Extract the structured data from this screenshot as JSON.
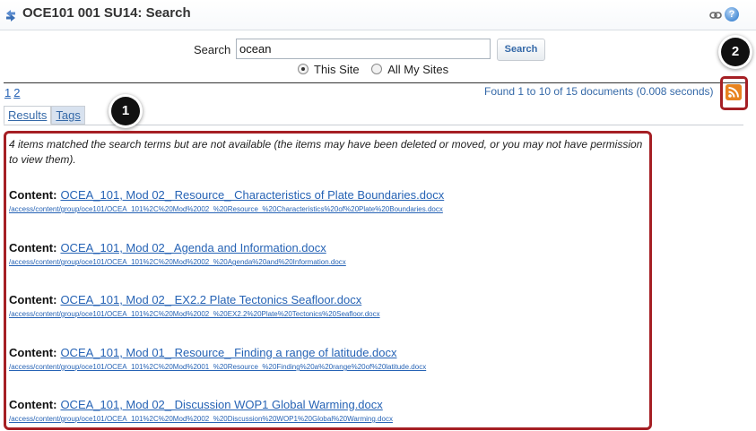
{
  "header": {
    "title": "OCE101 001 SU14: Search",
    "title_icon": "reset-arrows-icon",
    "link_icon": "link-icon",
    "help_icon": "help-icon",
    "help_glyph": "?"
  },
  "search": {
    "label": "Search",
    "value": "ocean",
    "button_label": "Search",
    "scope_options": [
      {
        "label": "This Site",
        "selected": true
      },
      {
        "label": "All My Sites",
        "selected": false
      }
    ]
  },
  "pagination": {
    "pages": [
      "1",
      "2"
    ]
  },
  "results_summary": "Found 1 to 10 of 15 documents (0.008 seconds)",
  "tabs": [
    {
      "label": "Results",
      "active": true
    },
    {
      "label": "Tags",
      "active": false
    }
  ],
  "notice": "4 items matched the search terms but are not available (the items may have been deleted or moved, or you may not have permission to view them).",
  "results": [
    {
      "label": "Content:",
      "title": "OCEA_101, Mod 02_ Resource_ Characteristics of Plate Boundaries.docx",
      "url": "/access/content/group/oce101/OCEA_101%2C%20Mod%2002_%20Resource_%20Characteristics%20of%20Plate%20Boundaries.docx"
    },
    {
      "label": "Content:",
      "title": "OCEA_101, Mod 02_ Agenda and Information.docx",
      "url": "/access/content/group/oce101/OCEA_101%2C%20Mod%2002_%20Agenda%20and%20Information.docx"
    },
    {
      "label": "Content:",
      "title": "OCEA_101, Mod 02_ EX2.2 Plate Tectonics Seafloor.docx",
      "url": "/access/content/group/oce101/OCEA_101%2C%20Mod%2002_%20EX2.2%20Plate%20Tectonics%20Seafloor.docx"
    },
    {
      "label": "Content:",
      "title": "OCEA_101, Mod 01_ Resource_ Finding a range of latitude.docx",
      "url": "/access/content/group/oce101/OCEA_101%2C%20Mod%2001_%20Resource_%20Finding%20a%20range%20of%20latitude.docx"
    },
    {
      "label": "Content:",
      "title": "OCEA_101, Mod 02_ Discussion WOP1 Global Warming.docx",
      "url": "/access/content/group/oce101/OCEA_101%2C%20Mod%2002_%20Discussion%20WOP1%20Global%20Warming.docx"
    }
  ],
  "callouts": [
    "1",
    "2"
  ],
  "colors": {
    "highlight": "#a51f24",
    "link": "#2663b5",
    "rss": "#e0731b"
  }
}
